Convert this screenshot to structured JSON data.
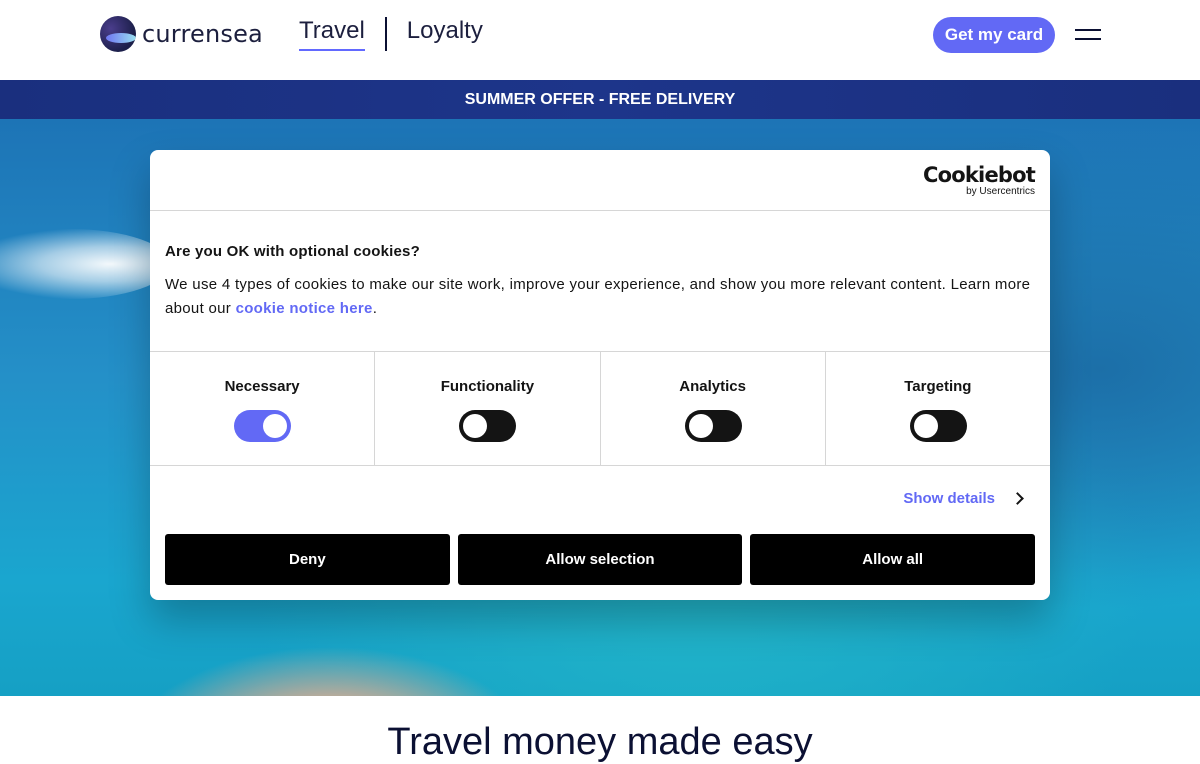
{
  "header": {
    "logo_text": "currensea",
    "nav": {
      "travel": "Travel",
      "loyalty": "Loyalty"
    },
    "cta_label": "Get my card",
    "menu_icon": "hamburger-menu-icon"
  },
  "banner": {
    "text": "SUMMER OFFER - FREE DELIVERY"
  },
  "cookie_dialog": {
    "brand": {
      "name": "Cookiebot",
      "by": "by Usercentrics"
    },
    "title": "Are you OK with optional cookies?",
    "body_text": "We use 4 types of cookies to make our site work, improve your experience, and show you more relevant content. Learn more about our ",
    "link_text": "cookie notice here",
    "body_end": ".",
    "categories": [
      {
        "label": "Necessary",
        "enabled": true
      },
      {
        "label": "Functionality",
        "enabled": false
      },
      {
        "label": "Analytics",
        "enabled": false
      },
      {
        "label": "Targeting",
        "enabled": false
      }
    ],
    "show_details": "Show details",
    "buttons": {
      "deny": "Deny",
      "allow_selection": "Allow selection",
      "allow_all": "Allow all"
    }
  },
  "hero_bottom": {
    "title": "Travel money made easy"
  },
  "colors": {
    "accent": "#6269f5",
    "banner": "#1a2f7e",
    "dark": "#0b1033"
  }
}
